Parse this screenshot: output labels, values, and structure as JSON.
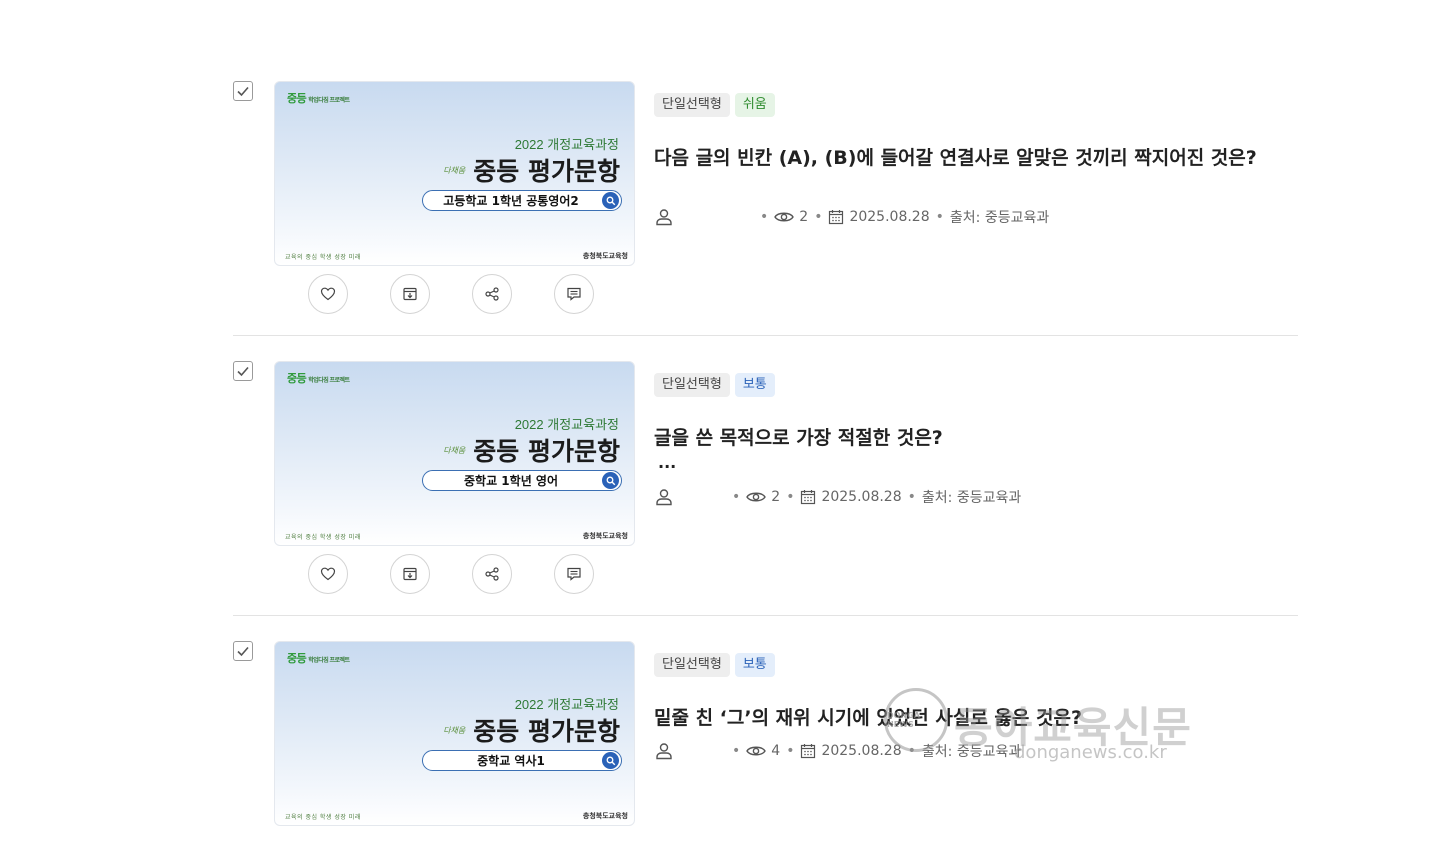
{
  "common": {
    "logo_text": "중등",
    "logo_sub": "학업다짐 프로젝트",
    "year_text": "2022 개정교육과정",
    "mini_text": "다채움",
    "main_text": "중등 평가문항",
    "footer_left": "교육의 중심 학생 성장 미래",
    "footer_right": "충청북도교육청"
  },
  "items": [
    {
      "thumb_subject": "고등학교 1학년 공통영어2",
      "type_tag": "단일선택형",
      "level_tag": "쉬움",
      "title": "다음 글의 빈칸 (A), (B)에 들어갈 연결사로 알맞은 것끼리 짝지어진 것은?",
      "ellipsis": "",
      "views": "2",
      "date": "2025.08.28",
      "source": "출처: 중등교육과"
    },
    {
      "thumb_subject": "중학교 1학년 영어",
      "type_tag": "단일선택형",
      "level_tag": "보통",
      "title": "글을 쓴 목적으로 가장 적절한 것은?",
      "ellipsis": "...",
      "views": "2",
      "date": "2025.08.28",
      "source": "출처: 중등교육과"
    },
    {
      "thumb_subject": "중학교 역사1",
      "type_tag": "단일선택형",
      "level_tag": "보통",
      "title": "밑줄 친 ‘그’의 재위 시기에 있었던 사실로 옳은 것은?",
      "ellipsis": "",
      "views": "4",
      "date": "2025.08.28",
      "source": "출처: 중등교육과"
    }
  ],
  "colors": {
    "easy_tag": "#2e8b2e",
    "normal_tag": "#2a62b8",
    "thumb_accent": "#2a62b8"
  },
  "icons": [
    "check-icon",
    "heart-icon",
    "archive-icon",
    "share-icon",
    "comment-icon",
    "user-icon",
    "eye-icon",
    "calendar-icon",
    "search-icon"
  ],
  "watermark": {
    "name": "동아교육신문",
    "url": "donganews.co.kr",
    "seal": "DONGA NEWS"
  }
}
